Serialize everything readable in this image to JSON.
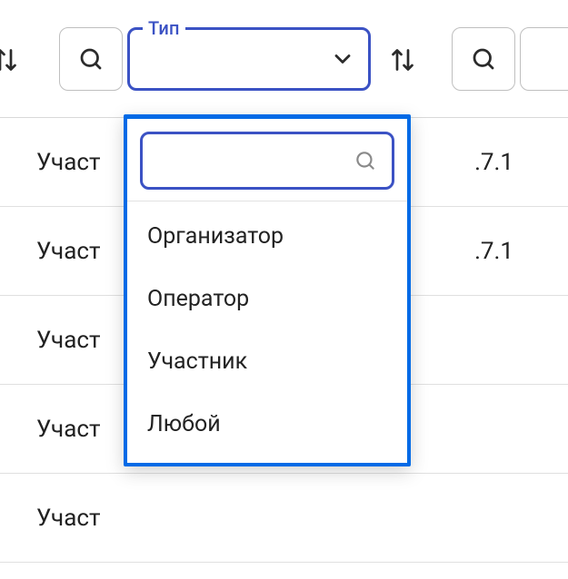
{
  "filters": {
    "type": {
      "label": "Тип",
      "selected": ""
    }
  },
  "dropdown": {
    "search": {
      "value": ""
    },
    "options": [
      {
        "label": "Организатор"
      },
      {
        "label": "Оператор"
      },
      {
        "label": "Участник"
      },
      {
        "label": "Любой"
      }
    ]
  },
  "rows": [
    {
      "col1_visible": "Участ",
      "col3_visible": ".7.1"
    },
    {
      "col1_visible": "Участ",
      "col3_visible": ".7.1"
    },
    {
      "col1_visible": "Участ",
      "col3_visible": ""
    },
    {
      "col1_visible": "Участ",
      "col3_visible": ""
    },
    {
      "col1_visible": "Участ",
      "col3_visible": ""
    }
  ]
}
